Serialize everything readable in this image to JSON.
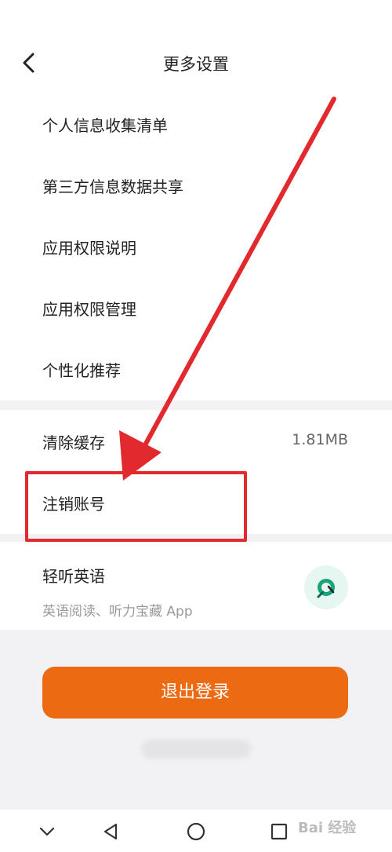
{
  "header": {
    "title": "更多设置",
    "back_icon": "chevron-left-icon"
  },
  "settings_group1": {
    "items": [
      {
        "label": "个人信息收集清单"
      },
      {
        "label": "第三方信息数据共享"
      },
      {
        "label": "应用权限说明"
      },
      {
        "label": "应用权限管理"
      },
      {
        "label": "个性化推荐"
      }
    ]
  },
  "settings_group2": {
    "clear_cache": {
      "label": "清除缓存",
      "value": "1.81MB"
    },
    "cancel_account": {
      "label": "注销账号"
    }
  },
  "promo": {
    "title": "轻听英语",
    "subtitle": "英语阅读、听力宝藏 App",
    "logo_icon": "app-logo-icon"
  },
  "logout_button": {
    "label": "退出登录"
  },
  "navbar": {
    "icons": [
      "chevron-down-icon",
      "back-triangle-icon",
      "home-circle-icon",
      "recents-square-icon"
    ]
  },
  "watermark": {
    "text": "Bai 经验"
  },
  "colors": {
    "accent": "#eb6a12",
    "annotation": "#e22a2e"
  }
}
